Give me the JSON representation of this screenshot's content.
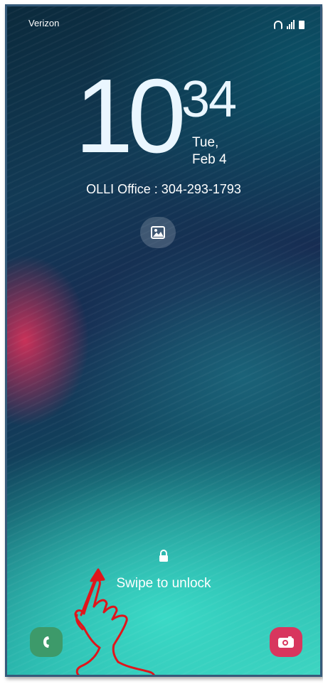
{
  "status_bar": {
    "carrier": "Verizon",
    "icons": [
      "wifi-icon",
      "signal-icon",
      "battery-icon"
    ]
  },
  "clock": {
    "hour": "10",
    "minute": "34",
    "day": "Tue,",
    "date": "Feb 4"
  },
  "owner_info": "OLLI Office : 304-293-1793",
  "gallery_shortcut": {
    "icon": "image-icon"
  },
  "lock": {
    "icon": "lock-icon",
    "hint": "Swipe to unlock"
  },
  "shortcuts": {
    "left": {
      "icon": "phone-icon",
      "color": "#3d9a6a"
    },
    "right": {
      "icon": "camera-icon",
      "color": "#d8365e"
    }
  },
  "annotation": {
    "icon": "swipe-hand-icon",
    "color": "#e0151b"
  }
}
